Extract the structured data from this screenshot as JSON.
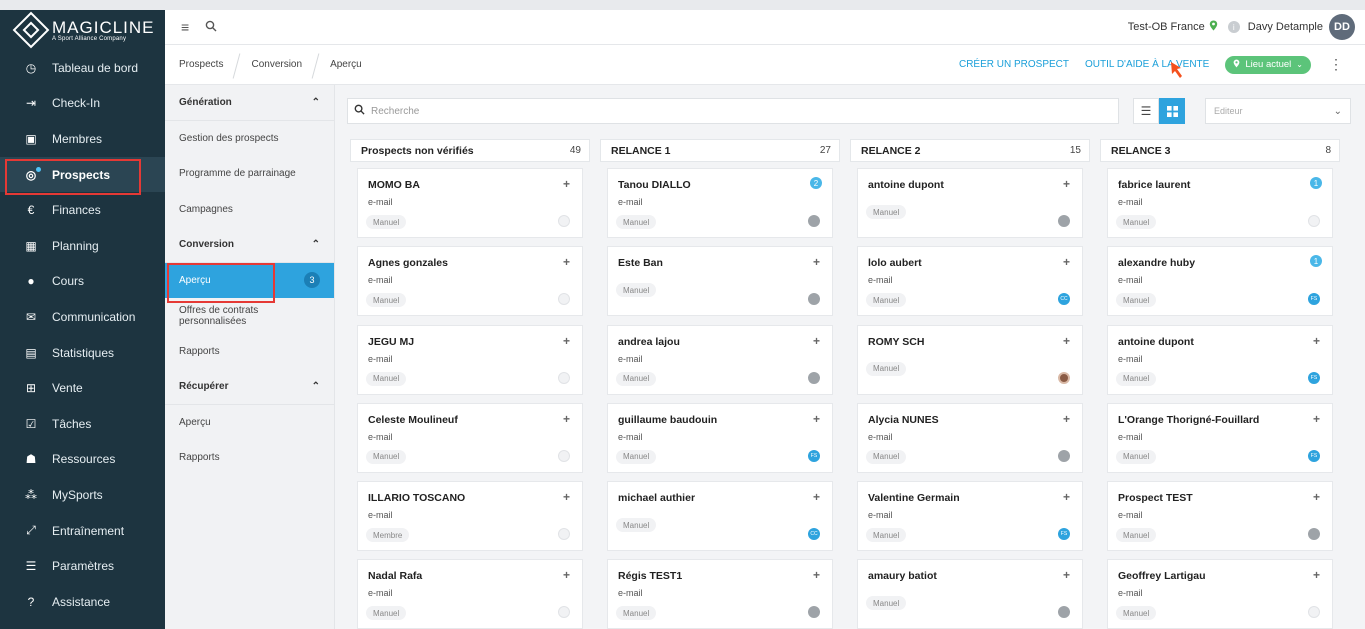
{
  "brand": {
    "title": "MAGICLINE",
    "subtitle": "A Sport Alliance Company"
  },
  "sidebar": {
    "items": [
      {
        "label": "Tableau de bord",
        "icon": "dashboard-icon",
        "glyph": "◷",
        "active": false
      },
      {
        "label": "Check-In",
        "icon": "checkin-icon",
        "glyph": "⇥",
        "active": false
      },
      {
        "label": "Membres",
        "icon": "members-icon",
        "glyph": "▣",
        "active": false
      },
      {
        "label": "Prospects",
        "icon": "prospects-icon",
        "glyph": "◎",
        "active": true
      },
      {
        "label": "Finances",
        "icon": "finances-icon",
        "glyph": "€",
        "active": false
      },
      {
        "label": "Planning",
        "icon": "calendar-icon",
        "glyph": "▦",
        "active": false
      },
      {
        "label": "Cours",
        "icon": "courses-icon",
        "glyph": "●",
        "active": false
      },
      {
        "label": "Communication",
        "icon": "chat-icon",
        "glyph": "✉",
        "active": false
      },
      {
        "label": "Statistiques",
        "icon": "statistics-icon",
        "glyph": "▤",
        "active": false
      },
      {
        "label": "Vente",
        "icon": "cart-icon",
        "glyph": "⊞",
        "active": false
      },
      {
        "label": "Tâches",
        "icon": "tasks-icon",
        "glyph": "☑",
        "active": false
      },
      {
        "label": "Ressources",
        "icon": "resources-icon",
        "glyph": "☗",
        "active": false
      },
      {
        "label": "MySports",
        "icon": "mysports-icon",
        "glyph": "⁂",
        "active": false
      },
      {
        "label": "Entraînement",
        "icon": "training-icon",
        "glyph": "⤢",
        "active": false
      },
      {
        "label": "Paramètres",
        "icon": "settings-icon",
        "glyph": "☰",
        "active": false
      },
      {
        "label": "Assistance",
        "icon": "help-icon",
        "glyph": "?",
        "active": false
      }
    ]
  },
  "topbar": {
    "studio": "Test-OB France",
    "user": "Davy Detample",
    "initials": "DD"
  },
  "breadcrumb": [
    "Prospects",
    "Conversion",
    "Aperçu"
  ],
  "actions": {
    "create": "CRÉER UN PROSPECT",
    "sales_tool": "OUTIL D'AIDE À LA VENTE",
    "location": "Lieu actuel"
  },
  "submenu": {
    "sections": [
      {
        "title": "Génération",
        "items": [
          {
            "label": "Gestion des prospects"
          },
          {
            "label": "Programme de parrainage"
          },
          {
            "label": "Campagnes"
          }
        ]
      },
      {
        "title": "Conversion",
        "items": [
          {
            "label": "Aperçu",
            "badge": "3",
            "active": true
          },
          {
            "label": "Offres de contrats personnalisées"
          },
          {
            "label": "Rapports"
          }
        ]
      },
      {
        "title": "Récupérer",
        "items": [
          {
            "label": "Aperçu"
          },
          {
            "label": "Rapports"
          }
        ]
      }
    ]
  },
  "search": {
    "placeholder": "Recherche"
  },
  "editor": {
    "placeholder": "Editeur"
  },
  "columns": [
    {
      "title": "Prospects non vérifiés",
      "count": "49",
      "cards": [
        {
          "name": "MOMO BA",
          "email": "e-mail",
          "tag": "Manuel",
          "action": "+",
          "status": "empty"
        },
        {
          "name": "Agnes gonzales",
          "email": "e-mail",
          "tag": "Manuel",
          "action": "+",
          "status": "empty"
        },
        {
          "name": "JEGU MJ",
          "email": "e-mail",
          "tag": "Manuel",
          "action": "+",
          "status": "empty"
        },
        {
          "name": "Celeste Moulineuf",
          "email": "e-mail",
          "tag": "Manuel",
          "action": "+",
          "status": "empty"
        },
        {
          "name": "ILLARIO TOSCANO",
          "email": "e-mail",
          "tag": "Membre",
          "action": "+",
          "status": "empty"
        },
        {
          "name": "Nadal Rafa",
          "email": "e-mail",
          "tag": "Manuel",
          "action": "+",
          "status": "empty"
        }
      ]
    },
    {
      "title": "RELANCE 1",
      "count": "27",
      "cards": [
        {
          "name": "Tanou DIALLO",
          "email": "e-mail",
          "tag": "Manuel",
          "notif": "2",
          "status": "grey"
        },
        {
          "name": "Este Ban",
          "email": "",
          "tag": "Manuel",
          "action": "+",
          "status": "grey"
        },
        {
          "name": "andrea lajou",
          "email": "e-mail",
          "tag": "Manuel",
          "action": "+",
          "status": "grey"
        },
        {
          "name": "guillaume baudouin",
          "email": "e-mail",
          "tag": "Manuel",
          "action": "+",
          "status": "blue",
          "status_text": "FS"
        },
        {
          "name": "michael authier",
          "email": "",
          "tag": "Manuel",
          "action": "+",
          "status": "blue",
          "status_text": "CC"
        },
        {
          "name": "Régis TEST1",
          "email": "e-mail",
          "tag": "Manuel",
          "action": "+",
          "status": "grey"
        }
      ]
    },
    {
      "title": "RELANCE 2",
      "count": "15",
      "cards": [
        {
          "name": "antoine dupont",
          "email": "",
          "tag": "Manuel",
          "action": "+",
          "status": "grey"
        },
        {
          "name": "lolo aubert",
          "email": "e-mail",
          "tag": "Manuel",
          "action": "+",
          "status": "blue",
          "status_text": "CC"
        },
        {
          "name": "ROMY SCH",
          "email": "",
          "tag": "Manuel",
          "action": "+",
          "status": "photo"
        },
        {
          "name": "Alycia NUNES",
          "email": "e-mail",
          "tag": "Manuel",
          "action": "+",
          "status": "grey"
        },
        {
          "name": "Valentine Germain",
          "email": "e-mail",
          "tag": "Manuel",
          "action": "+",
          "status": "blue",
          "status_text": "FS"
        },
        {
          "name": "amaury batiot",
          "email": "",
          "tag": "Manuel",
          "action": "+",
          "status": "grey"
        }
      ]
    },
    {
      "title": "RELANCE 3",
      "count": "8",
      "cards": [
        {
          "name": "fabrice laurent",
          "email": "e-mail",
          "tag": "Manuel",
          "notif": "1",
          "status": "empty"
        },
        {
          "name": "alexandre huby",
          "email": "e-mail",
          "tag": "Manuel",
          "notif": "1",
          "status": "blue",
          "status_text": "FS"
        },
        {
          "name": "antoine dupont",
          "email": "e-mail",
          "tag": "Manuel",
          "action": "+",
          "status": "blue",
          "status_text": "FS"
        },
        {
          "name": "L'Orange Thorigné-Fouillard",
          "email": "e-mail",
          "tag": "Manuel",
          "action": "+",
          "status": "blue",
          "status_text": "FS"
        },
        {
          "name": "Prospect TEST",
          "email": "e-mail",
          "tag": "Manuel",
          "action": "+",
          "status": "grey"
        },
        {
          "name": "Geoffrey Lartigau",
          "email": "e-mail",
          "tag": "Manuel",
          "action": "+",
          "status": "empty"
        }
      ]
    }
  ],
  "colors": {
    "sidebar": "#1d3440",
    "accent": "#2ea3de",
    "highlight": "#e53935",
    "location": "#5cc47a"
  }
}
